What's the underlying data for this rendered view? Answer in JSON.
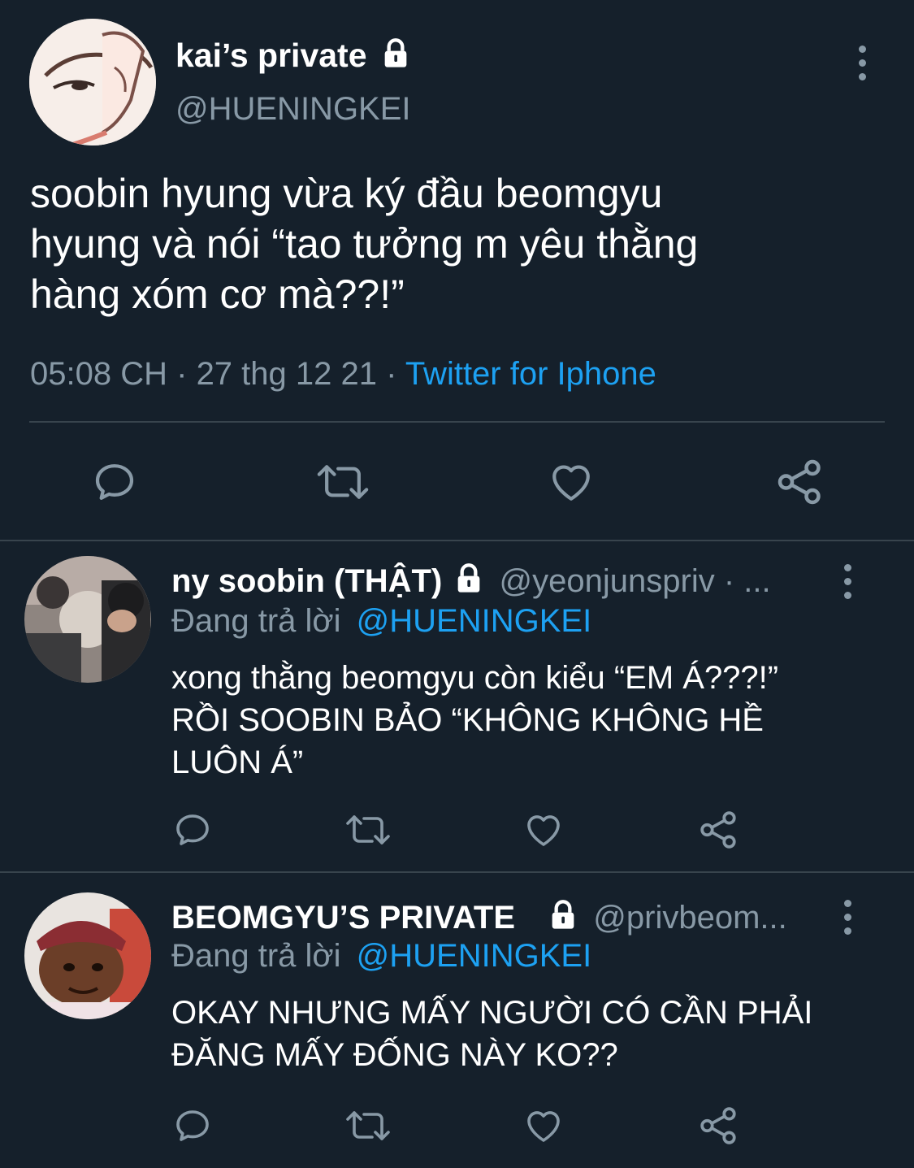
{
  "colors": {
    "background": "#15202b",
    "muted": "#8899a6",
    "link": "#1da1f2",
    "divider": "#38444d"
  },
  "main_tweet": {
    "display_name": "kai’s private",
    "handle": "@HUENINGKEI",
    "text_lines": [
      "soobin hyung vừa ký đầu beomgyu",
      "hyung và nói “tao tưởng m yêu thằng",
      "hàng xóm cơ mà??!”"
    ],
    "time": "05:08 CH",
    "sep1": "·",
    "date": "27 thg 12 21",
    "sep2": "·",
    "source": "Twitter for Iphone",
    "icons": [
      "lock-icon",
      "more-icon",
      "reply-icon",
      "retweet-icon",
      "like-icon",
      "share-icon"
    ]
  },
  "replies": [
    {
      "display_name": "ny soobin (THẬT)",
      "handle_meta": "@yeonjunspriv · ...",
      "replying_prefix": "Đang trả lời",
      "replying_to": "@HUENINGKEI",
      "text_lines": [
        "xong thằng beomgyu còn kiểu “EM Á???!”",
        "RỒI SOOBIN BẢO “KHÔNG KHÔNG HỀ",
        "LUÔN Á”"
      ]
    },
    {
      "display_name": "BEOMGYU’S PRIVATE",
      "handle_meta": "@privbeom...",
      "replying_prefix": "Đang trả lời",
      "replying_to": "@HUENINGKEI",
      "text_lines": [
        "OKAY NHƯNG MẤY NGƯỜI CÓ CẦN PHẢI",
        "ĐĂNG MẤY ĐỐNG NÀY KO??"
      ]
    }
  ]
}
